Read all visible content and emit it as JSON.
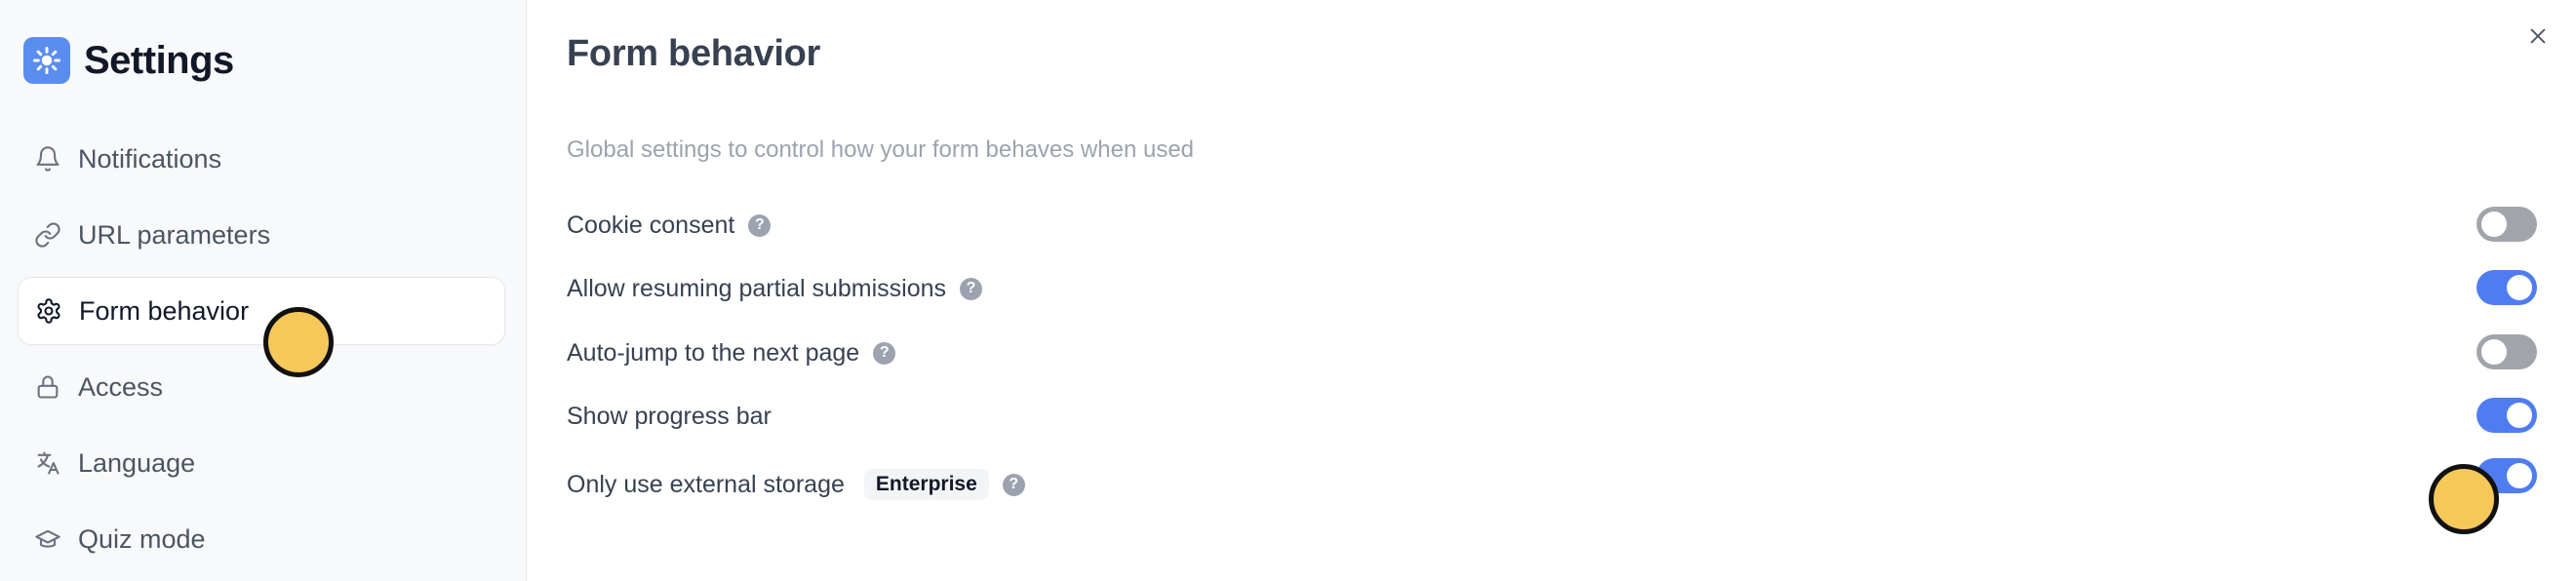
{
  "sidebar": {
    "title": "Settings",
    "items": [
      {
        "label": "Notifications",
        "icon": "bell-icon",
        "active": false
      },
      {
        "label": "URL parameters",
        "icon": "link-icon",
        "active": false
      },
      {
        "label": "Form behavior",
        "icon": "gear-icon",
        "active": true
      },
      {
        "label": "Access",
        "icon": "lock-icon",
        "active": false
      },
      {
        "label": "Language",
        "icon": "translate-icon",
        "active": false
      },
      {
        "label": "Quiz mode",
        "icon": "graduation-cap-icon",
        "active": false
      }
    ]
  },
  "main": {
    "title": "Form behavior",
    "description": "Global settings to control how your form behaves when used",
    "settings": [
      {
        "label": "Cookie consent",
        "enabled": false,
        "help": "?"
      },
      {
        "label": "Allow resuming partial submissions",
        "enabled": true,
        "help": "?"
      },
      {
        "label": "Auto-jump to the next page",
        "enabled": false,
        "help": "?"
      },
      {
        "label": "Show progress bar",
        "enabled": true
      },
      {
        "label": "Only use external storage",
        "badge": "Enterprise",
        "enabled": true,
        "help": "?"
      }
    ]
  },
  "colors": {
    "accent": "#4f7df0",
    "toggle_off": "#a1a5ab",
    "brand_icon": "#5b8def",
    "cursor_marker": "#f6c85a"
  }
}
